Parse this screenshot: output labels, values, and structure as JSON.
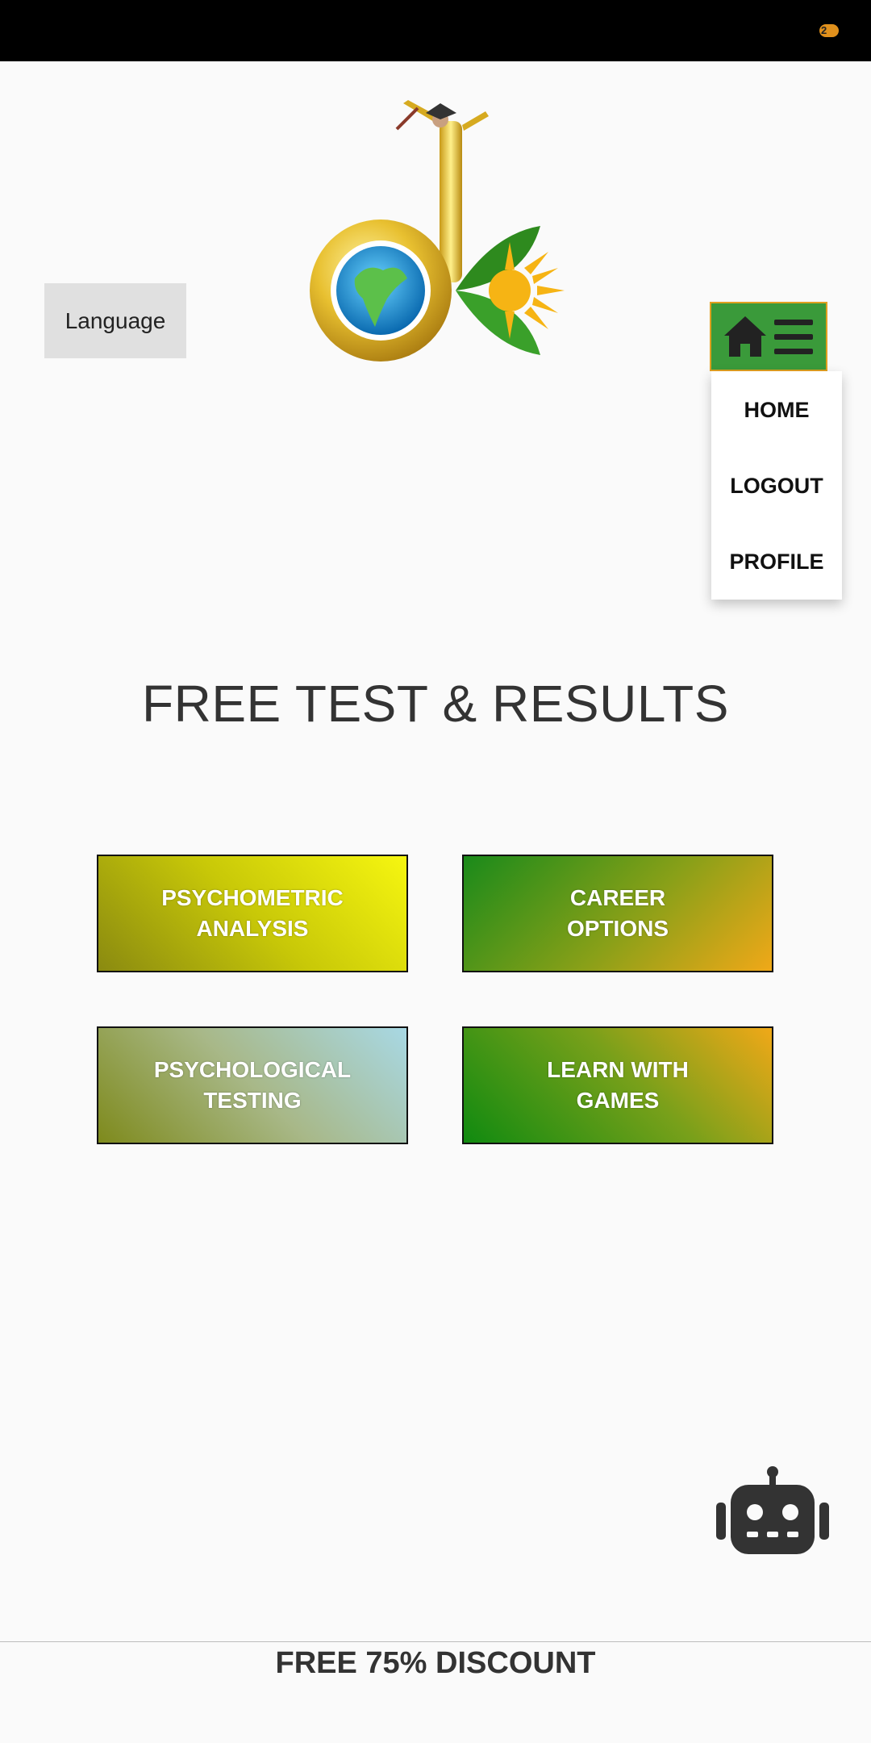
{
  "language_button": {
    "label": "Language"
  },
  "menu": {
    "items": [
      {
        "label": "HOME"
      },
      {
        "label": "LOGOUT"
      },
      {
        "label": "PROFILE"
      }
    ]
  },
  "page_title": "FREE TEST & RESULTS",
  "tiles": [
    {
      "line1": "PSYCHOMETRIC",
      "line2": "ANALYSIS"
    },
    {
      "line1": "CAREER",
      "line2": "OPTIONS"
    },
    {
      "line1": "PSYCHOLOGICAL",
      "line2": "TESTING"
    },
    {
      "line1": "LEARN WITH",
      "line2": "GAMES"
    }
  ],
  "footer": {
    "text": "FREE 75% DISCOUNT"
  },
  "icons": {
    "menu": [
      "home-icon",
      "hamburger-icon"
    ],
    "chatbot": "robot-icon",
    "logo": "dk-logo"
  },
  "colors": {
    "menu_button": "#3a9a3a",
    "menu_border": "#e0a020",
    "status_bar": "#000000",
    "background": "#fafafa"
  }
}
